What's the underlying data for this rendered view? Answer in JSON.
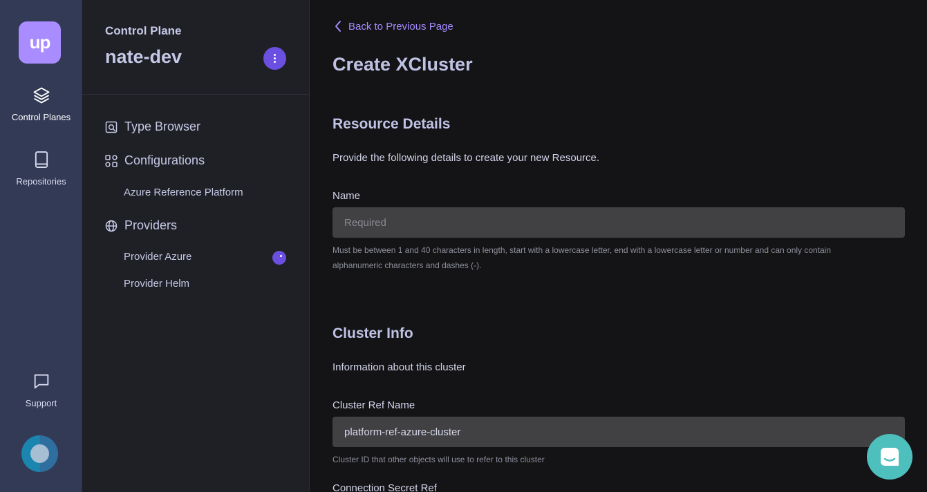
{
  "rail": {
    "logo_text": "up",
    "items": [
      {
        "label": "Control Planes",
        "icon": "layers-icon"
      },
      {
        "label": "Repositories",
        "icon": "book-icon"
      },
      {
        "label": "Support",
        "icon": "chat-icon"
      }
    ]
  },
  "panel": {
    "label": "Control Plane",
    "name": "nate-dev",
    "type_browser": "Type Browser",
    "configurations": "Configurations",
    "config_items": [
      "Azure Reference Platform"
    ],
    "providers": "Providers",
    "provider_items": [
      "Provider Azure",
      "Provider Helm"
    ]
  },
  "main": {
    "back_label": "Back to Previous Page",
    "title": "Create XCluster",
    "resource": {
      "title": "Resource Details",
      "desc": "Provide the following details to create your new Resource.",
      "name_label": "Name",
      "name_placeholder": "Required",
      "name_help_1": "Must be between 1 and 40 characters in length, start with a lowercase letter, end with a lowercase letter or number and can only contain",
      "name_help_2": "alphanumeric characters and dashes (-)."
    },
    "cluster": {
      "title": "Cluster Info",
      "desc": "Information about this cluster",
      "ref_label": "Cluster Ref Name",
      "ref_value": "platform-ref-azure-cluster",
      "ref_help": "Cluster ID that other objects will use to refer to this cluster",
      "secret_label": "Connection Secret Ref"
    }
  },
  "colors": {
    "accent": "#a68bff",
    "brand": "#6a4fe0",
    "chat": "#4dbfbd"
  }
}
